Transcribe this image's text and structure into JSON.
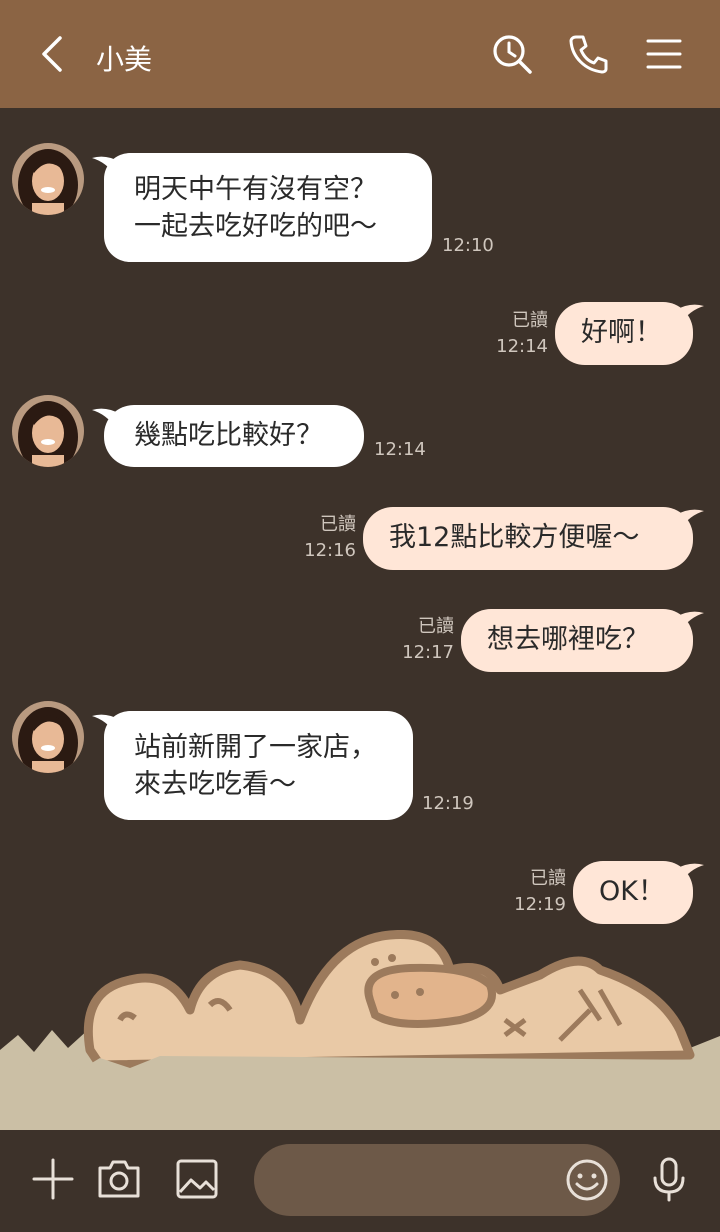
{
  "header": {
    "title": "小美",
    "bg_color": "#8b6444",
    "icons": [
      "back-icon",
      "search-history-icon",
      "phone-icon",
      "menu-icon"
    ]
  },
  "messages": [
    {
      "dir": "in",
      "text": "明天中午有沒有空？\n一起去吃好吃的吧～",
      "time": "12:10"
    },
    {
      "dir": "out",
      "text": "好啊！",
      "read": "已讀",
      "time": "12:14"
    },
    {
      "dir": "in",
      "text": "幾點吃比較好？",
      "time": "12:14"
    },
    {
      "dir": "out",
      "text": "我12點比較方便喔～",
      "read": "已讀",
      "time": "12:16"
    },
    {
      "dir": "out",
      "text": "想去哪裡吃？",
      "read": "已讀",
      "time": "12:17"
    },
    {
      "dir": "in",
      "text": "站前新開了一家店，\n來去吃吃看～",
      "time": "12:19"
    },
    {
      "dir": "out",
      "text": "OK！",
      "read": "已讀",
      "time": "12:19"
    }
  ],
  "colors": {
    "chat_bg": "#3d322a",
    "incoming_bubble": "#ffffff",
    "outgoing_bubble": "#ffe6d7",
    "meta_text": "#cfc6bd",
    "input_bg": "#6d5948"
  },
  "bottombar": {
    "icons": [
      "plus-icon",
      "camera-icon",
      "image-icon",
      "emoji-icon",
      "microphone-icon"
    ],
    "input_value": "",
    "input_placeholder": ""
  }
}
